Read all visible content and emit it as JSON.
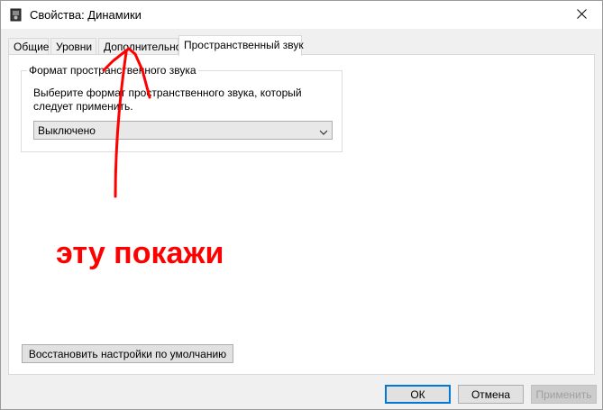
{
  "window": {
    "title": "Свойства: Динамики",
    "close_label": "✕"
  },
  "tabs": [
    {
      "label": "Общие",
      "active": false
    },
    {
      "label": "Уровни",
      "active": false
    },
    {
      "label": "Дополнительно",
      "active": false
    },
    {
      "label": "Пространственный звук",
      "active": true
    }
  ],
  "spatial_sound": {
    "group_title": "Формат пространственного звука",
    "description": "Выберите формат пространственного звука, который следует применить.",
    "select_value": "Выключено"
  },
  "restore_button": {
    "label": "Восстановить настройки по умолчанию"
  },
  "footer": {
    "ok": "ОК",
    "cancel": "Отмена",
    "apply": "Применить"
  },
  "annotation": {
    "text": "эту покажи",
    "color": "#ff0000"
  },
  "colors": {
    "accent": "#0078d7",
    "annotation": "#ff0000"
  }
}
